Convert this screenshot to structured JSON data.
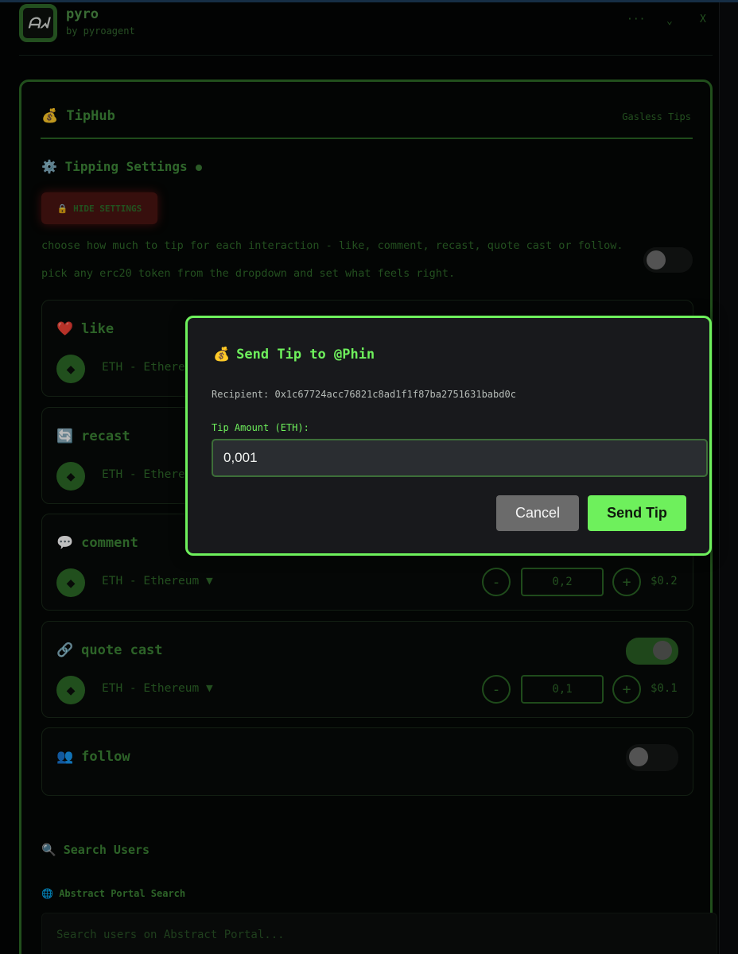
{
  "header": {
    "logo_text": "ᗩᖽ",
    "title": "pyro",
    "subtitle": "by pyroagent",
    "more_label": "···",
    "collapse_label": "⌄",
    "close_label": "X"
  },
  "card": {
    "icon": "💰",
    "title": "TipHub",
    "tag": "Gasless Tips"
  },
  "settings": {
    "icon": "⚙️",
    "title": "Tipping Settings",
    "hide_button": "🔒 HIDE SETTINGS",
    "desc_line1": "choose how much to tip for each interaction - like, comment, recast, quote cast or follow.",
    "desc_line2": "pick any erc20 token from the dropdown and set what feels right.",
    "master_toggle_on": false
  },
  "interactions": [
    {
      "icon": "❤️",
      "label": "like",
      "token": "ETH - Ethereum",
      "amount": "",
      "usd": "",
      "enabled": true
    },
    {
      "icon": "🔄",
      "label": "recast",
      "token": "ETH - Ethereum",
      "amount": "",
      "usd": "",
      "enabled": true
    },
    {
      "icon": "💬",
      "label": "comment",
      "token": "ETH - Ethereum ▼",
      "amount": "0,2",
      "usd": "$0.2",
      "enabled": true
    },
    {
      "icon": "🔗",
      "label": "quote cast",
      "token": "ETH - Ethereum ▼",
      "amount": "0,1",
      "usd": "$0.1",
      "enabled": true
    },
    {
      "icon": "👥",
      "label": "follow",
      "enabled": false
    }
  ],
  "controls": {
    "minus": "-",
    "plus": "+",
    "eth_icon": "◆"
  },
  "search": {
    "icon": "🔍",
    "title": "Search Users",
    "portal_icon": "🌐",
    "portal_title": "Abstract Portal Search",
    "placeholder": "Search users on Abstract Portal..."
  },
  "modal": {
    "icon": "💰",
    "title": "Send Tip to @Phin",
    "recipient_label": "Recipient:",
    "recipient_value": "0x1c67724acc76821c8ad1f1f87ba2751631babd0c",
    "amount_label": "Tip Amount (ETH):",
    "amount_value": "0,001",
    "cancel_label": "Cancel",
    "send_label": "Send Tip"
  },
  "colors": {
    "accent": "#6ef05c",
    "muted_green": "#2f6a2a",
    "modal_bg": "#18191c",
    "cancel_bg": "#6b6b6b"
  }
}
